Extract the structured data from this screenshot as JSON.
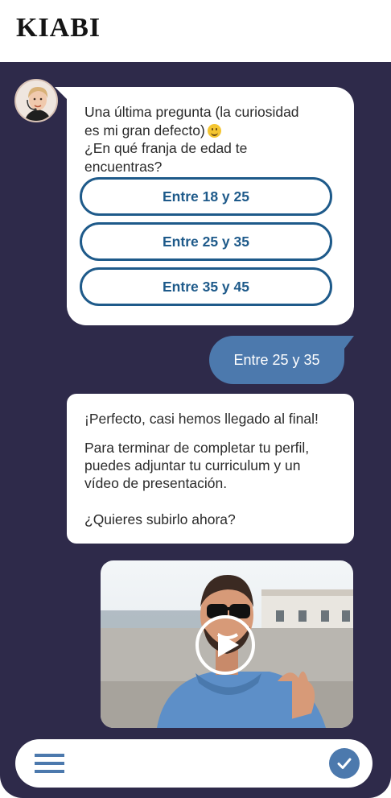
{
  "header": {
    "logo_text": "KIABI"
  },
  "chat": {
    "bot_message_1": {
      "line1": "Una última pregunta (la curiosidad",
      "line2": "es mi gran defecto)",
      "line3": "¿En qué franja de edad te",
      "line4": "encuentras?",
      "emoji": "smiling-face"
    },
    "options": [
      {
        "label": "Entre 18 y 25"
      },
      {
        "label": "Entre 25 y 35"
      },
      {
        "label": "Entre 35 y 45"
      }
    ],
    "user_reply": "Entre 25 y 35",
    "bot_message_2": {
      "line1": "¡Perfecto, casi hemos llegado al final!",
      "para2_line1": "Para terminar de completar tu perfil,",
      "para2_line2": "puedes adjuntar tu curriculum y un",
      "para2_line3": "vídeo de presentación.",
      "question": "¿Quieres subirlo ahora?"
    },
    "video": {
      "icon": "play-icon"
    }
  },
  "input_bar": {
    "menu_icon": "hamburger-menu-icon",
    "send_icon": "checkmark-icon"
  },
  "colors": {
    "chat_background": "#2e2a4a",
    "accent": "#1e5a8a",
    "user_bubble": "#4c79ad"
  }
}
